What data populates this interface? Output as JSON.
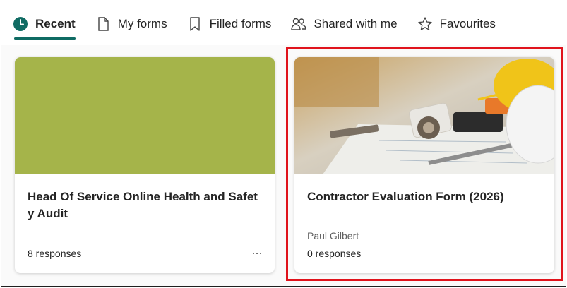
{
  "tabs": [
    {
      "label": "Recent",
      "icon": "clock-icon",
      "active": true
    },
    {
      "label": "My forms",
      "icon": "document-icon"
    },
    {
      "label": "Filled forms",
      "icon": "bookmark-icon"
    },
    {
      "label": "Shared with me",
      "icon": "people-icon"
    },
    {
      "label": "Favourites",
      "icon": "star-icon"
    }
  ],
  "cards": [
    {
      "title": "Head Of Service Online Health and Safety Audit",
      "responses": "8 responses",
      "more_label": "…",
      "banner_color": "#a5b44a"
    },
    {
      "title": "Contractor Evaluation Form (2026)",
      "owner": "Paul Gilbert",
      "responses": "0 responses"
    }
  ],
  "colors": {
    "accent": "#0f6b63",
    "highlight": "#e0131c"
  }
}
